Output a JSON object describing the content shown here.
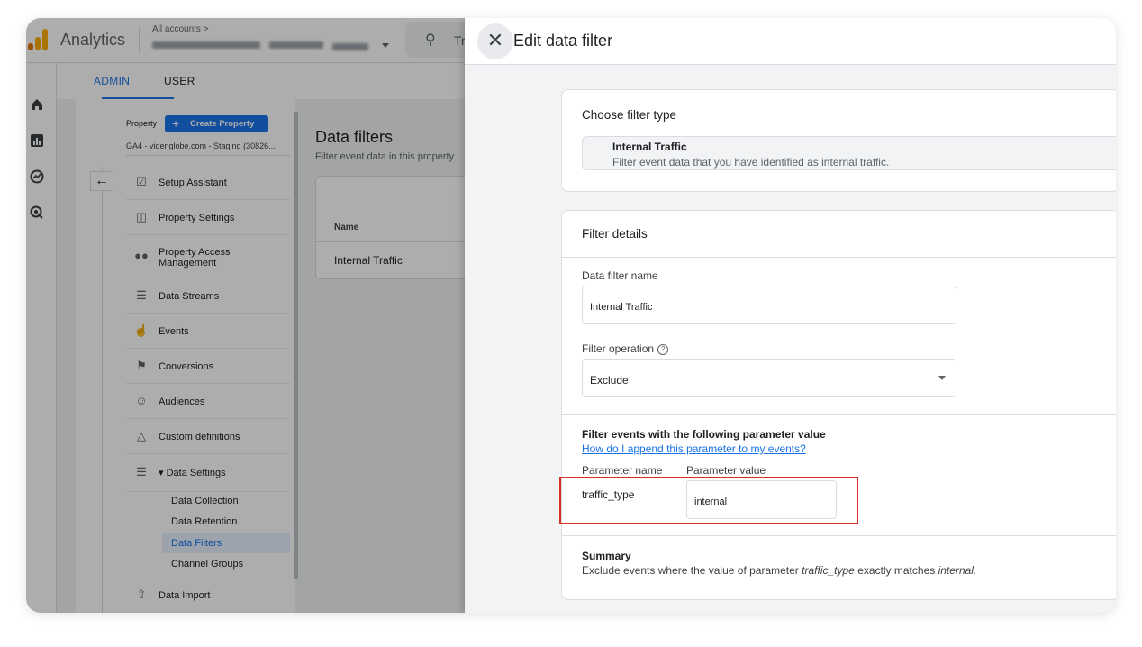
{
  "header": {
    "app_name": "Analytics",
    "accounts_breadcrumb": "All accounts >",
    "search_text": "Tr"
  },
  "tabs": [
    {
      "label": "ADMIN",
      "active": true
    },
    {
      "label": "USER",
      "active": false
    }
  ],
  "nav": {
    "property_label": "Property",
    "create_property": "Create Property",
    "property_name": "GA4 - videnglobe.com - Staging (30826...",
    "items": [
      {
        "label": "Setup Assistant",
        "icon": "checklist-icon"
      },
      {
        "label": "Property Settings",
        "icon": "property-settings-icon"
      },
      {
        "label": "Property Access\nManagement",
        "icon": "people-icon"
      },
      {
        "label": "Data Streams",
        "icon": "streams-icon"
      },
      {
        "label": "Events",
        "icon": "touch-icon"
      },
      {
        "label": "Conversions",
        "icon": "flag-icon"
      },
      {
        "label": "Audiences",
        "icon": "audience-icon"
      },
      {
        "label": "Custom definitions",
        "icon": "shapes-icon"
      },
      {
        "label": "Data Settings",
        "icon": "database-icon"
      },
      {
        "label": "Data Import",
        "icon": "upload-icon"
      }
    ],
    "sub_items": [
      {
        "label": "Data Collection",
        "active": false
      },
      {
        "label": "Data Retention",
        "active": false
      },
      {
        "label": "Data Filters",
        "active": true
      },
      {
        "label": "Channel Groups",
        "active": false
      }
    ]
  },
  "content": {
    "title": "Data filters",
    "subtitle": "Filter event data in this property",
    "column_name": "Name",
    "row_value": "Internal Traffic"
  },
  "drawer": {
    "title": "Edit data filter",
    "filter_type_card": {
      "title": "Choose filter type",
      "type_name": "Internal Traffic",
      "type_desc": "Filter event data that you have identified as internal traffic."
    },
    "details_card": {
      "title": "Filter details",
      "name_label": "Data filter name",
      "name_value": "Internal Traffic",
      "operation_label": "Filter operation",
      "operation_value": "Exclude",
      "param_section_title": "Filter events with the following parameter value",
      "param_help_link": "How do I append this parameter to my events?",
      "param_name_header": "Parameter name",
      "param_value_header": "Parameter value",
      "param_name": "traffic_type",
      "param_value": "internal",
      "summary_title": "Summary",
      "summary_prefix": "Exclude events where the value of parameter",
      "summary_param": "traffic_type",
      "summary_middle": "exactly matches",
      "summary_value": "internal."
    }
  },
  "colors": {
    "accent": "#1a73e8",
    "highlight": "#d93025",
    "logo_orange": "#f9ab00",
    "logo_dark_orange": "#e37400"
  }
}
